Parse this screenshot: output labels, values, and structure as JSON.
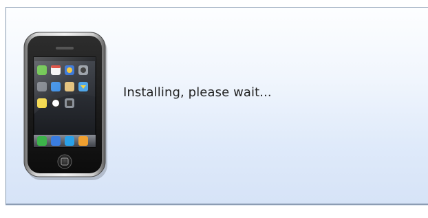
{
  "installer": {
    "status_message": "Installing, please wait...",
    "device_icon": "iphone-device-icon"
  },
  "colors": {
    "panel_border": "#8497ae",
    "panel_gradient_top": "#fdfeff",
    "panel_gradient_bottom": "#d6e3f7",
    "text": "#222222"
  }
}
